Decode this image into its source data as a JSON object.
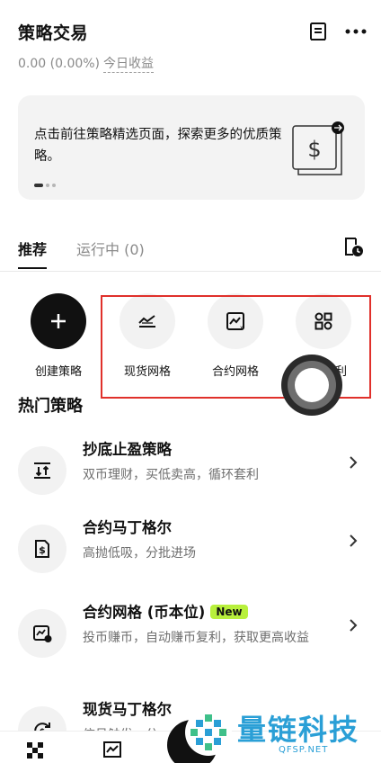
{
  "header": {
    "title": "策略交易",
    "pnl_value": "0.00 (0.00%)",
    "pnl_label": "今日收益"
  },
  "banner": {
    "text": "点击前往策略精选页面，探索更多的优质策略。",
    "dots_total": 3,
    "dots_active": 1
  },
  "tabs": {
    "recommended": "推荐",
    "running": "运行中 (0)"
  },
  "quick_actions": [
    {
      "label": "创建策略",
      "icon": "plus-icon"
    },
    {
      "label": "现货网格",
      "icon": "spot-grid-icon"
    },
    {
      "label": "合约网格",
      "icon": "futures-grid-icon"
    },
    {
      "label": "价差套利",
      "icon": "arbitrage-icon"
    }
  ],
  "section": {
    "hot_title": "热门策略"
  },
  "strategies": [
    {
      "name": "抄底止盈策略",
      "desc": "双币理财，买低卖高，循环套利",
      "icon": "bottom-fishing-icon"
    },
    {
      "name": "合约马丁格尔",
      "desc": "高抛低吸，分批进场",
      "icon": "futures-martingale-icon"
    },
    {
      "name": "合约网格 (币本位)",
      "badge": "New",
      "desc": "投币赚币，自动赚币复利，获取更高收益",
      "icon": "coin-grid-icon"
    },
    {
      "name": "现货马丁格尔",
      "desc": "信号触发，分",
      "icon": "spot-martingale-icon"
    }
  ],
  "watermark": {
    "text": "量链科技",
    "sub": "QFSP.NET"
  },
  "colors": {
    "highlight_border": "#e0302b",
    "new_badge": "#b8f03c",
    "watermark": "#2a9fd6"
  }
}
